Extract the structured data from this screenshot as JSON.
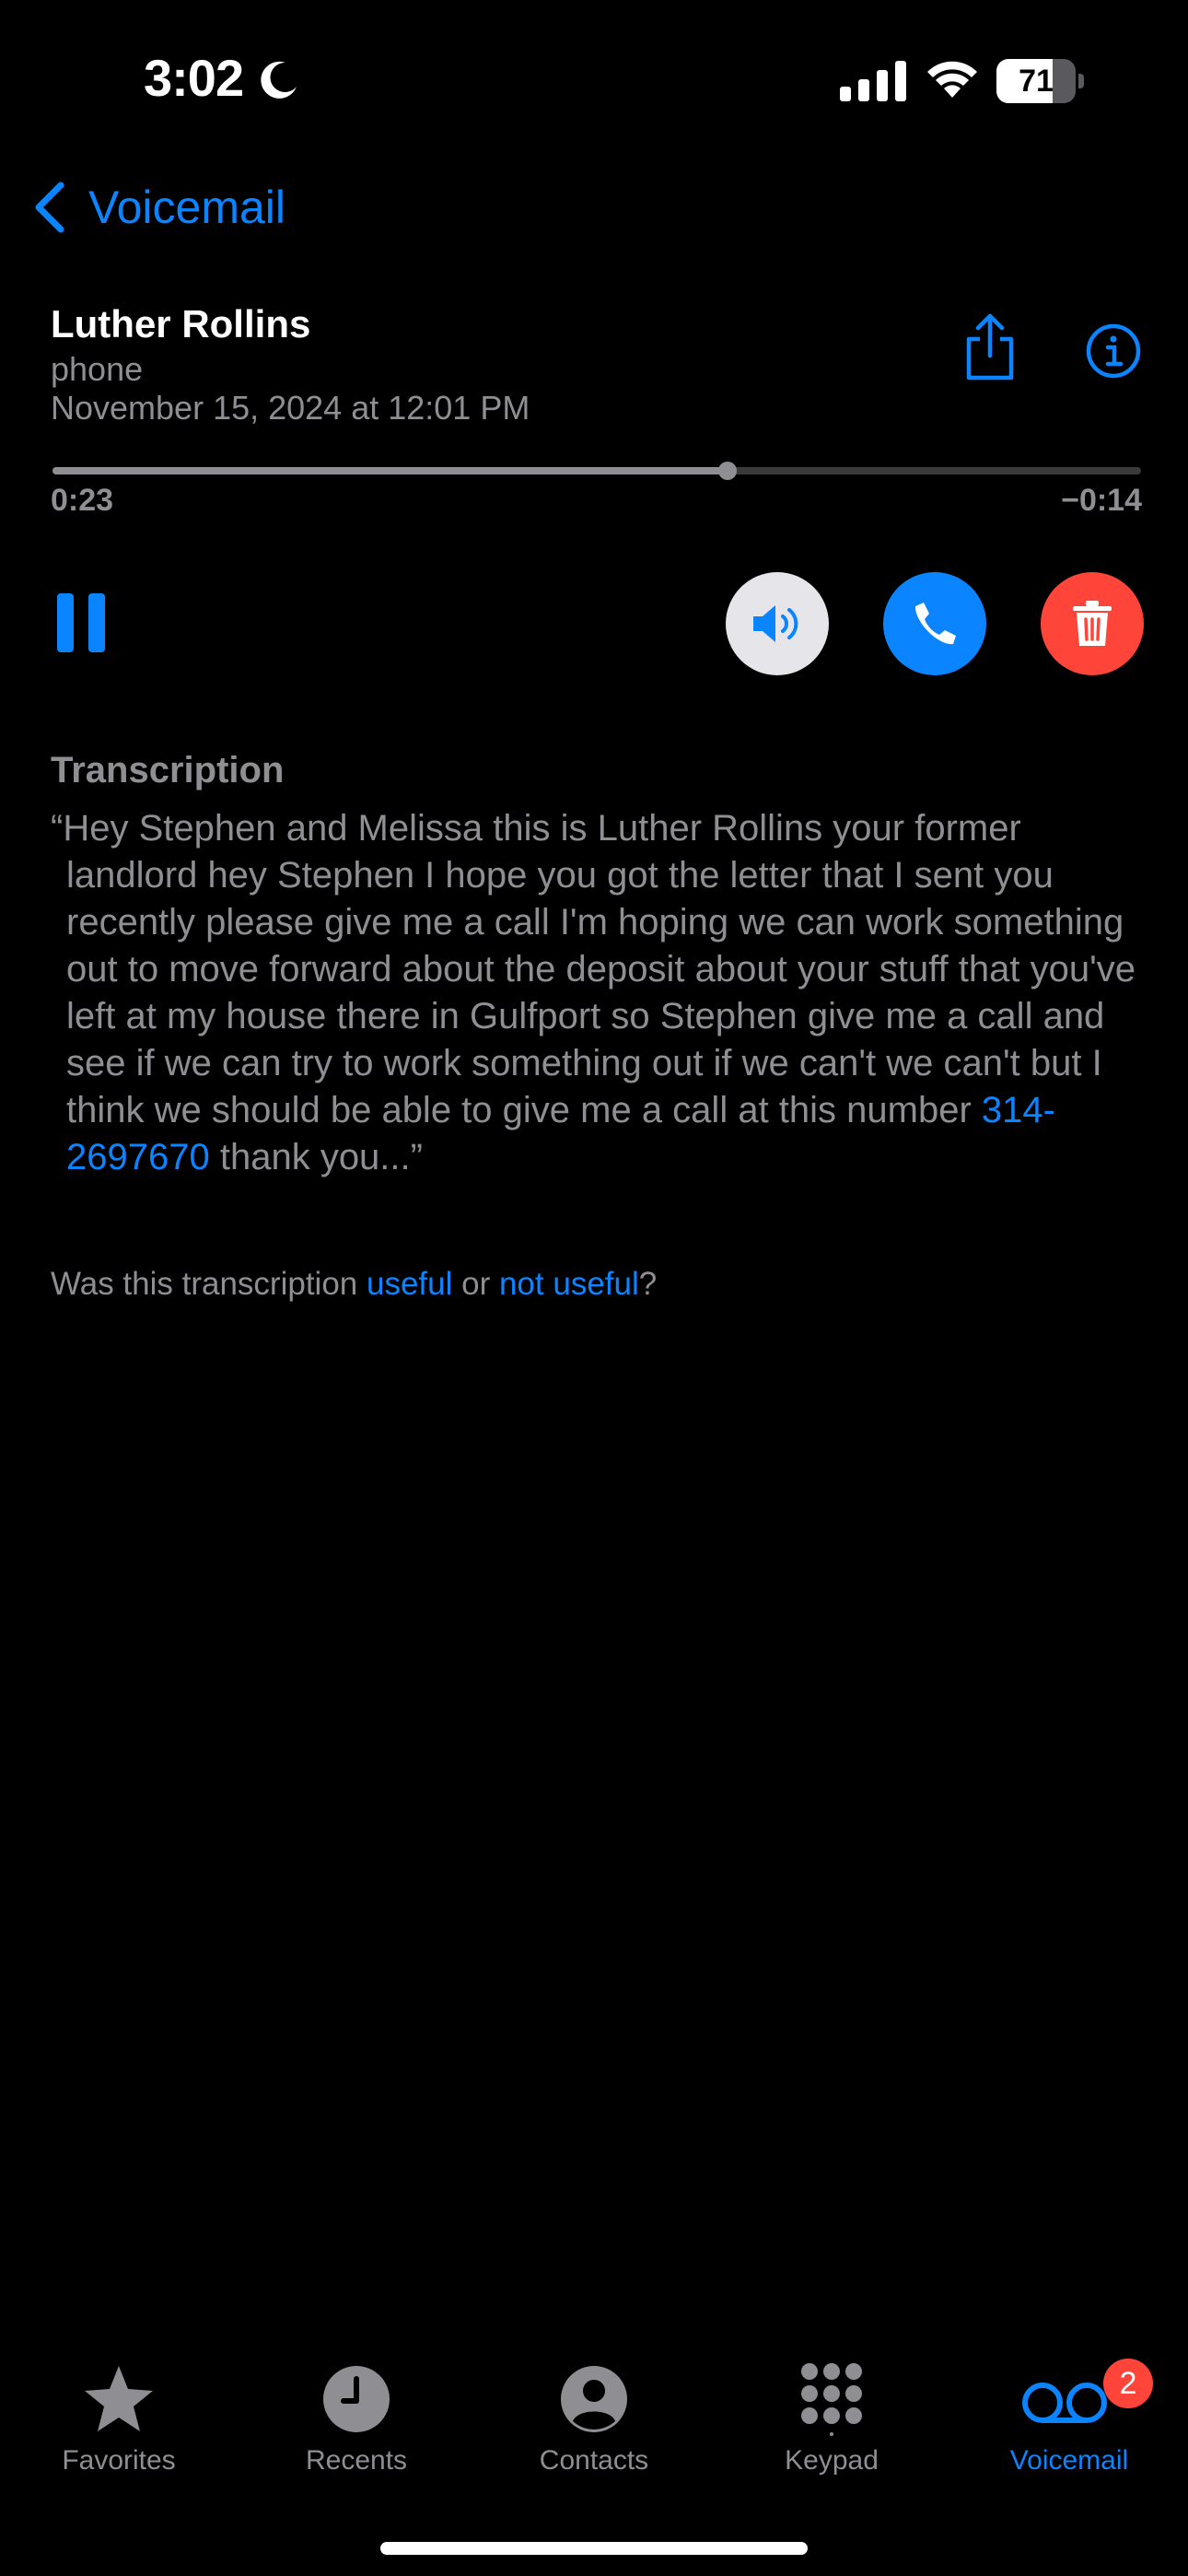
{
  "status_bar": {
    "time": "3:02",
    "battery": "71",
    "battery_level": 0.71,
    "icons": [
      "moon-icon",
      "cellular-signal-icon",
      "wifi-icon",
      "battery-icon"
    ]
  },
  "nav": {
    "back_label": "Voicemail"
  },
  "message": {
    "caller_name": "Luther Rollins",
    "caller_label": "phone",
    "date": "November 15, 2024 at 12:01 PM"
  },
  "playback": {
    "elapsed": "0:23",
    "remaining": "−0:14",
    "progress": 0.62
  },
  "transcription": {
    "heading": "Transcription",
    "text_before": "“Hey Stephen and Melissa this is Luther Rollins your former landlord hey Stephen I hope you got the letter that I sent you recently please give me a call I'm hoping we can work something out to move forward about the deposit about your stuff that you've left at my house there in Gulfport so Stephen give me a call and see if we can try to work something out if we can't we can't but I think we should be able to give me a call at this number ",
    "phone_link": "314-2697670",
    "text_after": " thank you...”"
  },
  "feedback": {
    "prefix": "Was this transcription ",
    "useful": "useful",
    "or": " or ",
    "not_useful": "not useful",
    "suffix": "?"
  },
  "tabs": [
    {
      "label": "Favorites",
      "icon": "star-icon"
    },
    {
      "label": "Recents",
      "icon": "clock-icon"
    },
    {
      "label": "Contacts",
      "icon": "person-icon"
    },
    {
      "label": "Keypad",
      "icon": "keypad-icon"
    },
    {
      "label": "Voicemail",
      "icon": "voicemail-icon",
      "badge": "2",
      "active": true
    }
  ],
  "colors": {
    "accent": "#0a84ff",
    "destructive": "#ff453a",
    "secondary_text": "#8e8e93",
    "background": "#000000"
  }
}
